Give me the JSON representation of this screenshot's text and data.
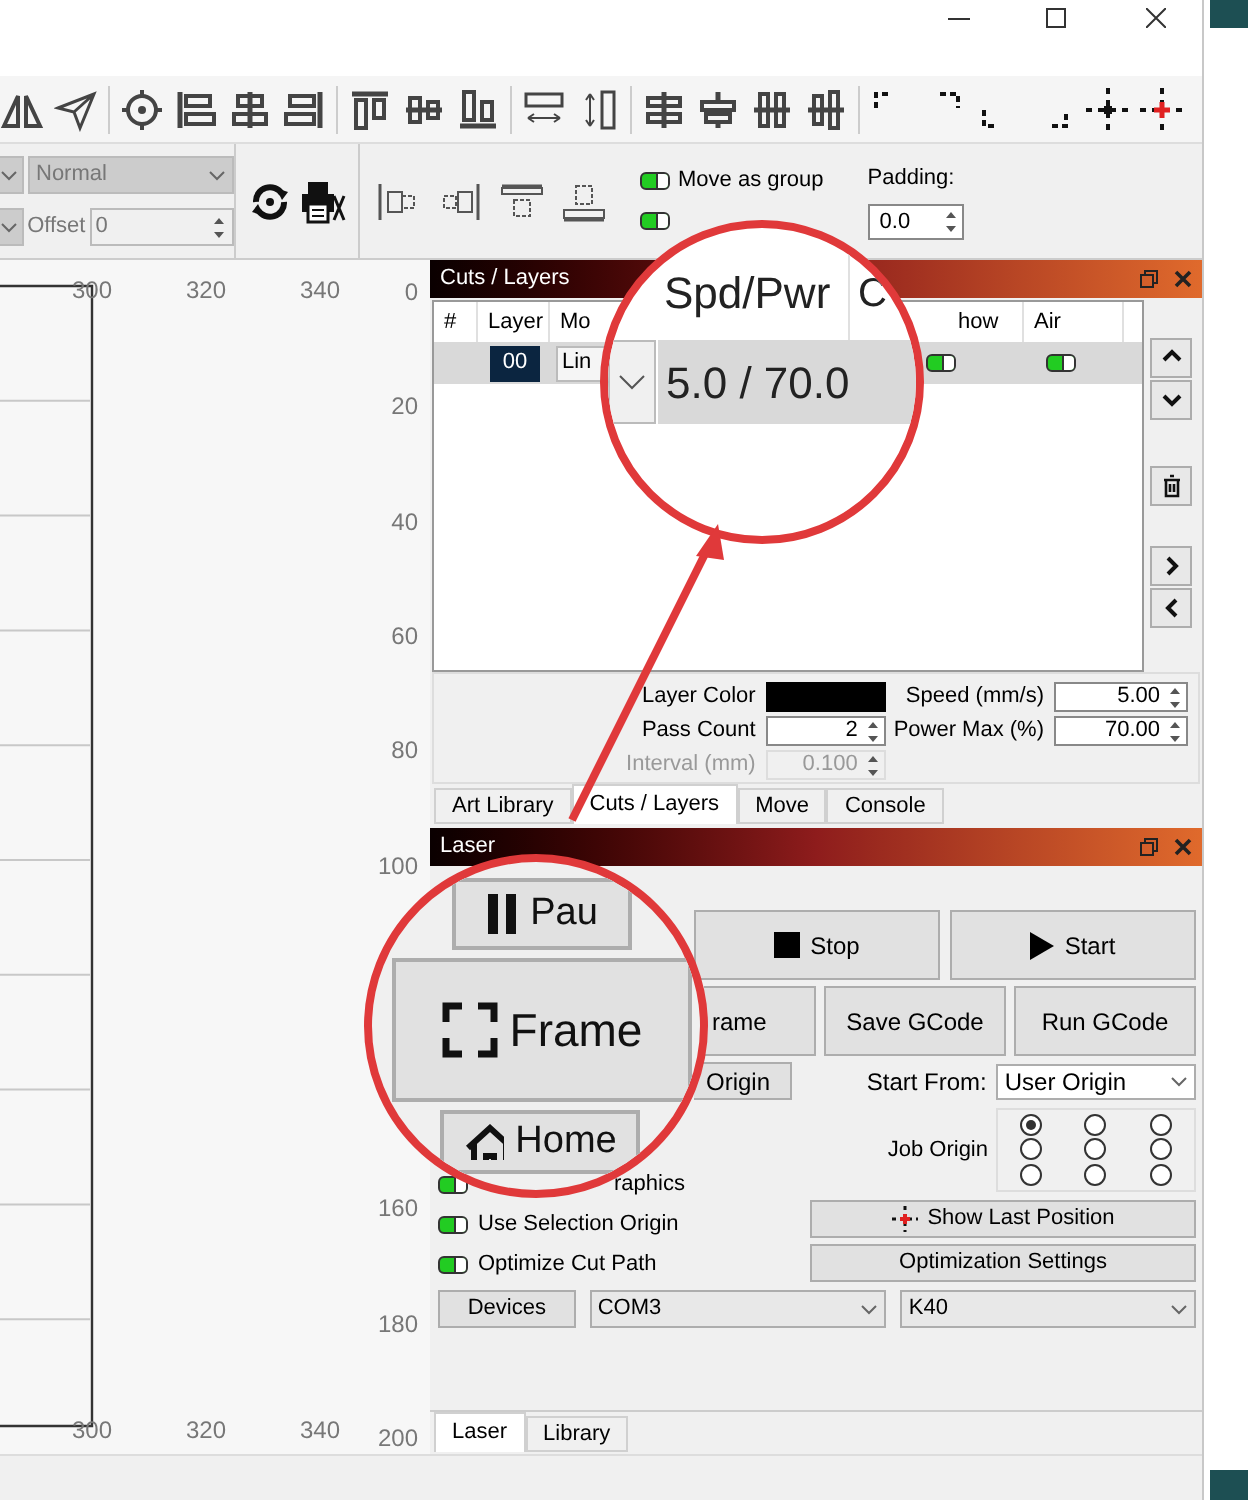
{
  "toolbar2": {
    "mode_dropdown": {
      "value": "Normal",
      "disabled": true
    },
    "offset": {
      "label": "Offset",
      "value": "0"
    },
    "toggles": [
      {
        "label": "Move as group",
        "on": true
      },
      {
        "on": true
      }
    ],
    "padding": {
      "label": "Padding:",
      "value": "0.0"
    }
  },
  "canvas": {
    "top_ruler": [
      "300",
      "320",
      "340"
    ],
    "bottom_ruler": [
      "300",
      "320",
      "340"
    ],
    "side_ruler_upper": [
      "0",
      "20",
      "40",
      "60",
      "80",
      "100"
    ],
    "side_ruler_lower": [
      "160",
      "180",
      "200"
    ]
  },
  "cuts_panel": {
    "title": "Cuts / Layers",
    "columns": [
      "#",
      "Layer",
      "Mo",
      "how",
      "Air"
    ],
    "rows": [
      {
        "layer": "00",
        "mode": "Lin",
        "show": true,
        "air": true,
        "selected": true
      }
    ],
    "properties": {
      "layer_color": {
        "label": "Layer Color",
        "color": "#000000"
      },
      "pass_count": {
        "label": "Pass Count",
        "value": "2"
      },
      "interval": {
        "label": "Interval (mm)",
        "value": "0.100",
        "disabled": true
      },
      "speed": {
        "label": "Speed (mm/s)",
        "value": "5.00"
      },
      "power": {
        "label": "Power Max (%)",
        "value": "70.00"
      }
    },
    "tabs": [
      {
        "label": "Art Library",
        "selected": false
      },
      {
        "label": "Cuts / Layers",
        "selected": true
      },
      {
        "label": "Move",
        "selected": false
      },
      {
        "label": "Console",
        "selected": false
      }
    ]
  },
  "laser_panel": {
    "title": "Laser",
    "stop": "Stop",
    "start": "Start",
    "frame": "rame",
    "save_gcode": "Save GCode",
    "run_gcode": "Run GCode",
    "origin": "Origin",
    "start_from": {
      "label": "Start From:",
      "value": "User Origin"
    },
    "job_origin": {
      "label": "Job Origin",
      "options": [
        {
          "selected": true
        },
        {
          "selected": false
        },
        {
          "selected": false
        },
        {
          "selected": false
        },
        {
          "selected": false
        },
        {
          "selected": false
        },
        {
          "selected": false
        },
        {
          "selected": false
        },
        {
          "selected": false
        }
      ]
    },
    "toggles": [
      {
        "label": "raphics",
        "on": true
      },
      {
        "label": "Use Selection Origin",
        "on": true
      },
      {
        "label": "Optimize Cut Path",
        "on": true
      }
    ],
    "show_last_position": "Show Last Position",
    "optimization_settings": "Optimization Settings",
    "devices": "Devices",
    "port": "COM3",
    "device": "K40",
    "tabs": [
      {
        "label": "Laser",
        "selected": true
      },
      {
        "label": "Library",
        "selected": false
      }
    ]
  },
  "magnifiers": [
    {
      "header": "Spd/Pwr",
      "header_2": "C",
      "value": "5.0 / 70.0"
    },
    {
      "buttons": [
        "Pau",
        "Frame",
        "Home"
      ]
    }
  ]
}
